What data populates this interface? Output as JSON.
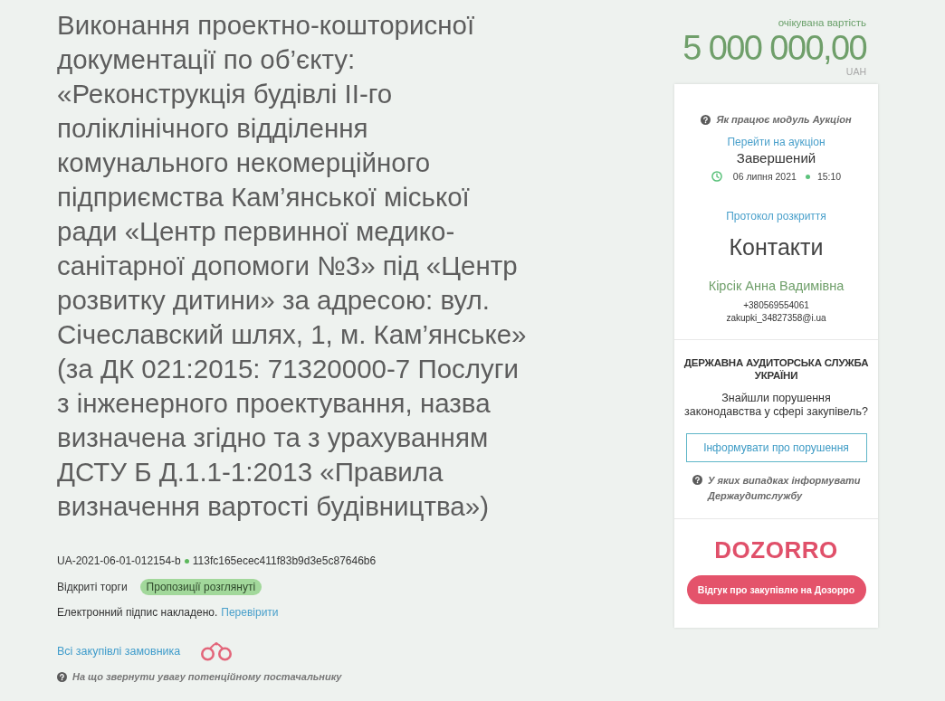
{
  "tender": {
    "title": "Виконання проектно-кошторисної документації по об’єкту: «Реконструкція будівлі ІІ-го поліклінічного відділення комунального некомерційного підприємства Кам’янської міської ради «Центр первинної медико-санітарної допомоги №3» під «Центр розвитку дитини» за адресою: вул. Січеславский шлях, 1, м. Кам’янське» (за ДК 021:2015: 71320000-7 Послуги з інженерного проектування, назва визначена згідно та з урахуванням ДСТУ Б Д.1.1-1:2013 «Правила визначення вартості будівництва»)",
    "id": "UA-2021-06-01-012154-b",
    "hash": "113fc165ecec411f83b9d3e5c87646b6",
    "procedure": "Відкриті торги",
    "status_badge": "Пропозиції розглянуті",
    "signature_text": "Електронний підпис накладено.",
    "signature_link": "Перевірити",
    "buyer_link": "Всі закупівлі замовника",
    "help_link": "На що звернути увагу потенційному постачальнику"
  },
  "price": {
    "label": "очікувана вартість",
    "amount": "5 000 000,00",
    "currency": "UAH"
  },
  "auction": {
    "help": "Як працює модуль Аукціон",
    "link": "Перейти на аукціон",
    "status": "Завершений",
    "date": "06 липня 2021",
    "time": "15:10",
    "protocol_link": "Протокол розкриття"
  },
  "contacts": {
    "title": "Контакти",
    "name": "Кірсік Анна Вадимівна",
    "phone": "+380569554061",
    "email": "zakupki_34827358@i.ua"
  },
  "audit": {
    "title": "ДЕРЖАВНА АУДИТОРСЬКА СЛУЖБА УКРАЇНИ",
    "question": "Знайшли порушення законодавства у сфері закупівель?",
    "button": "Інформувати про порушення",
    "help": "У яких випадках інформувати Держаудитслужбу"
  },
  "dozorro": {
    "logo": "DOZORRO",
    "button": "Відгук про закупівлю на Дозорро"
  }
}
